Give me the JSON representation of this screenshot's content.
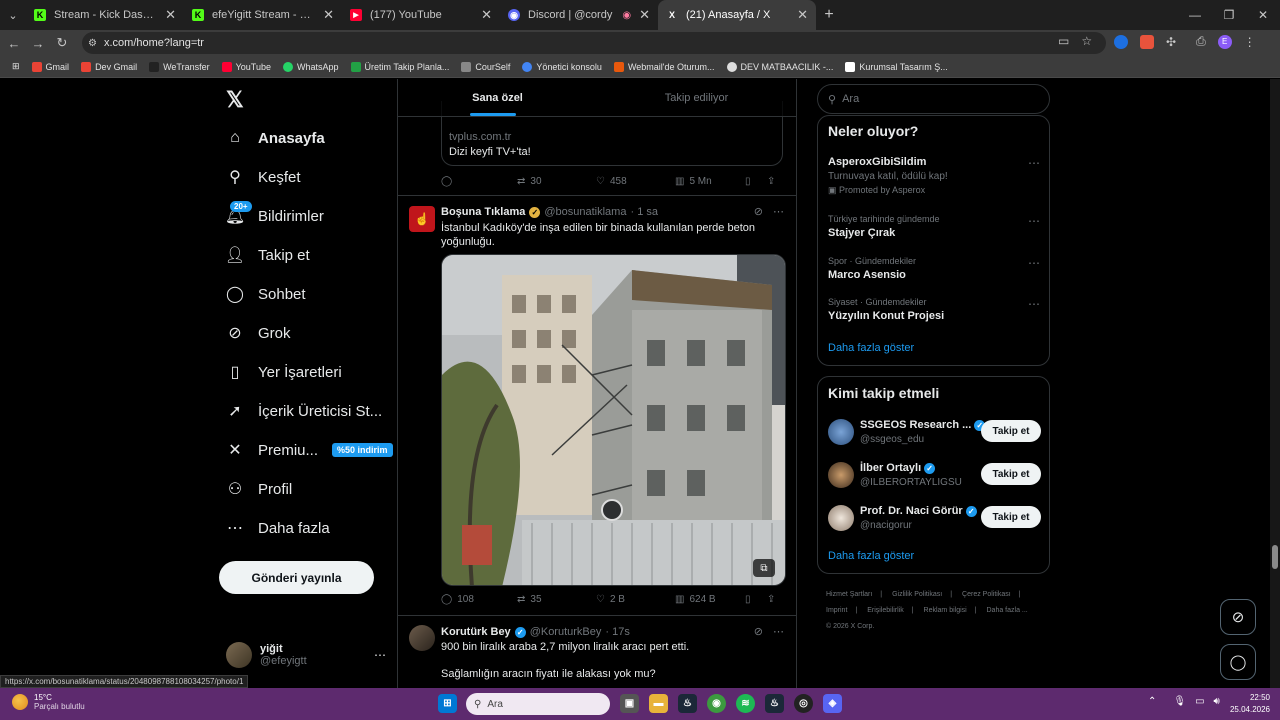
{
  "browser": {
    "tabs": [
      {
        "label": "Stream - Kick Dashboard",
        "fav": "K",
        "favColor": "#53fc18"
      },
      {
        "label": "efeYigitt Stream - Watch Live on Kick",
        "fav": "K",
        "favColor": "#53fc18"
      },
      {
        "label": "(177) YouTube",
        "fav": "▶",
        "favColor": "#ff0033"
      },
      {
        "label": "Discord | @cordy",
        "fav": "◉",
        "favColor": "#5865f2"
      },
      {
        "label": "(21) Anasayfa / X",
        "fav": "X",
        "favColor": "#ffffff"
      }
    ],
    "url": "x.com/home?lang=tr",
    "bookmarks": [
      {
        "label": "Gmail",
        "color": "#ea4335"
      },
      {
        "label": "Dev Gmail",
        "color": "#ea4335"
      },
      {
        "label": "WeTransfer",
        "color": "#111111"
      },
      {
        "label": "YouTube",
        "color": "#ff0033"
      },
      {
        "label": "WhatsApp",
        "color": "#25d366"
      },
      {
        "label": "Üretim Takip Planla...",
        "color": "#22a045"
      },
      {
        "label": "CourSelf",
        "color": "#888888"
      },
      {
        "label": "Yönetici konsolu",
        "color": "#4285f4"
      },
      {
        "label": "Webmail'de Oturum...",
        "color": "#e8580c"
      },
      {
        "label": "DEV MATBAACILIK -...",
        "color": "#dddddd"
      },
      {
        "label": "Kurumsal Tasarım Ş...",
        "color": "#ffffff"
      }
    ],
    "status_url": "https://x.com/bosunatiklama/status/2048098788108034257/photo/1"
  },
  "nav": {
    "items": [
      {
        "label": "Anasayfa",
        "icon": "home-icon"
      },
      {
        "label": "Keşfet",
        "icon": "search-icon"
      },
      {
        "label": "Bildirimler",
        "icon": "bell-icon"
      },
      {
        "label": "Takip et",
        "icon": "add-user-icon"
      },
      {
        "label": "Sohbet",
        "icon": "chat-icon"
      },
      {
        "label": "Grok",
        "icon": "grok-icon"
      },
      {
        "label": "Yer İşaretleri",
        "icon": "bookmark-icon"
      },
      {
        "label": "İçerik Üreticisi St...",
        "icon": "rocket-icon"
      },
      {
        "label": "Premiu...",
        "icon": "x-icon"
      },
      {
        "label": "Profil",
        "icon": "person-icon"
      },
      {
        "label": "Daha fazla",
        "icon": "more-icon"
      }
    ],
    "notif_badge": "20+",
    "premium_badge": "%50 indirim",
    "post_button": "Gönderi yayınla",
    "user_name": "yiğit",
    "user_handle": "@efeyigtt"
  },
  "feed": {
    "tabs": [
      "Sana özel",
      "Takip ediliyor"
    ],
    "card_domain": "tvplus.com.tr",
    "card_desc": "Dizi keyfi TV+'ta!",
    "top_actions": {
      "replies": "",
      "reposts": "30",
      "likes": "458",
      "views": "5 Mn"
    },
    "post1": {
      "name": "Boşuna Tıklama",
      "handle": "@bosunatiklama",
      "time": "· 1 sa",
      "text": "İstanbul Kadıköy'de inşa edilen bir binada kullanılan perde beton yoğunluğu.",
      "replies": "108",
      "reposts": "35",
      "likes": "2 B",
      "views": "624 B"
    },
    "post2": {
      "name": "Korutürk Bey",
      "handle": "@KoruturkBey",
      "time": "· 17s",
      "line1": "900 bin liralık araba 2,7 milyon liralık aracı pert etti.",
      "line2": "Sağlamlığın aracın fiyatı ile alakası yok mu?"
    }
  },
  "right": {
    "search_placeholder": "Ara",
    "trends_title": "Neler oluyor?",
    "trends": [
      {
        "meta": "",
        "name": "AsperoxGibiSildim",
        "sub": "Turnuvaya katıl, ödülü kap!",
        "promo": "Promoted by Asperox"
      },
      {
        "meta": "Türkiye tarihinde gündemde",
        "name": "Stajyer Çırak",
        "sub": "",
        "promo": ""
      },
      {
        "meta": "Spor · Gündemdekiler",
        "name": "Marco Asensio",
        "sub": "",
        "promo": ""
      },
      {
        "meta": "Siyaset · Gündemdekiler",
        "name": "Yüzyılın Konut Projesi",
        "sub": "",
        "promo": ""
      }
    ],
    "show_more": "Daha fazla göster",
    "who_title": "Kimi takip etmeli",
    "who": [
      {
        "name": "SSGEOS Research ...",
        "handle": "@ssgeos_edu",
        "btn": "Takip et"
      },
      {
        "name": "İlber Ortaylı",
        "handle": "@ILBERORTAYLIGSU",
        "btn": "Takip et"
      },
      {
        "name": "Prof. Dr. Naci Görür",
        "handle": "@nacigorur",
        "btn": "Takip et"
      }
    ],
    "footer": [
      "Hizmet Şartları",
      "|",
      "Gizlilik Politikası",
      "|",
      "Çerez Politikası",
      "|",
      "Imprint",
      "|",
      "Erişilebilirlik",
      "|",
      "Reklam bilgisi",
      "|",
      "Daha fazla ...",
      "© 2026 X Corp."
    ]
  },
  "taskbar": {
    "temp": "15°C",
    "weather": "Parçalı bulutlu",
    "search": "Ara",
    "time": "22:50",
    "date": "25.04.2026"
  }
}
